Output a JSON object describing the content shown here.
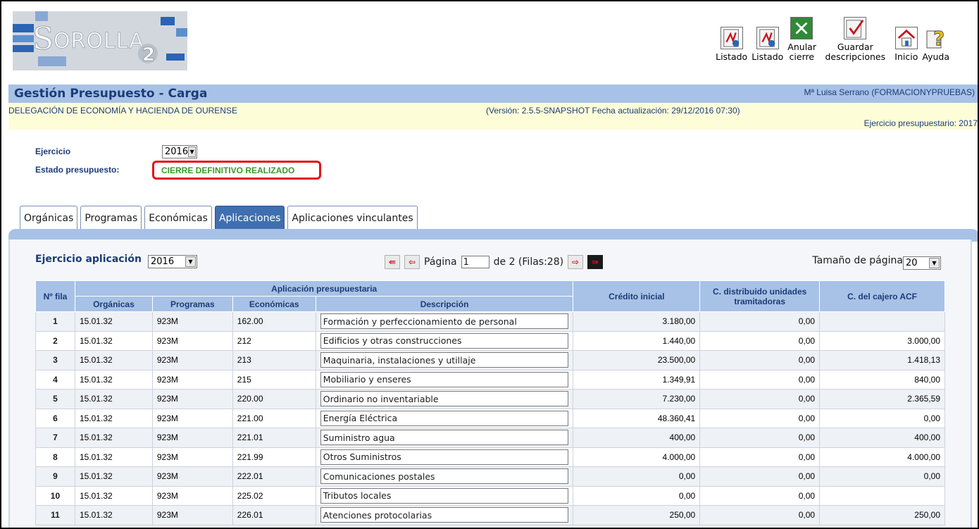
{
  "logo": {
    "text": "Sorolla",
    "number": "2"
  },
  "toolbar": [
    {
      "label": "Listado",
      "icon": "pdf-report-icon"
    },
    {
      "label": "Listado",
      "icon": "pdf-report-icon"
    },
    {
      "label": "Anular cierre",
      "icon": "cancel-x-icon"
    },
    {
      "label": "Guardar descripciones",
      "icon": "save-check-icon"
    },
    {
      "label": "Inicio",
      "icon": "home-icon"
    },
    {
      "label": "Ayuda",
      "icon": "help-icon"
    }
  ],
  "header": {
    "title": "Gestión Presupuesto - Carga",
    "user": "Mª Luisa Serrano (FORMACIONYPRUEBAS)",
    "delegation": "DELEGACIÓN DE ECONOMÍA Y HACIENDA DE OURENSE",
    "version": "(Versión: 2.5.5-SNAPSHOT Fecha actualización: 29/12/2016 07:30)",
    "ejercicio_presupuestario": "Ejercicio presupuestario: 2017"
  },
  "filters": {
    "ejercicio_label": "Ejercicio",
    "ejercicio_value": "2016",
    "estado_label": "Estado presupuesto:",
    "estado_value": "CIERRE DEFINITIVO REALIZADO"
  },
  "tabs": [
    {
      "label": "Orgánicas",
      "active": false
    },
    {
      "label": "Programas",
      "active": false
    },
    {
      "label": "Económicas",
      "active": false
    },
    {
      "label": "Aplicaciones",
      "active": true
    },
    {
      "label": "Aplicaciones vinculantes",
      "active": false
    }
  ],
  "panel": {
    "ejercicio_aplicacion_label": "Ejercicio aplicación",
    "ejercicio_aplicacion_value": "2016",
    "pagina_label": "Página",
    "pagina_value": "1",
    "pagina_total": "de 2 (Filas:28)",
    "tamano_label": "Tamaño de página",
    "tamano_value": "20"
  },
  "table": {
    "headers": {
      "nfila": "Nº fila",
      "aplicacion": "Aplicación presupuestaria",
      "organicas": "Orgánicas",
      "programas": "Programas",
      "economicas": "Económicas",
      "descripcion": "Descripción",
      "credito": "Crédito inicial",
      "distribuido": "C. distribuido unidades tramitadoras",
      "cajero": "C. del cajero ACF"
    },
    "rows": [
      {
        "n": "1",
        "org": "15.01.32",
        "prog": "923M",
        "eco": "162.00",
        "desc": "Formación y perfeccionamiento de personal",
        "credito": "3.180,00",
        "distribuido": "0,00",
        "cajero": ""
      },
      {
        "n": "2",
        "org": "15.01.32",
        "prog": "923M",
        "eco": "212",
        "desc": "Edificios y otras construcciones",
        "credito": "1.440,00",
        "distribuido": "0,00",
        "cajero": "3.000,00"
      },
      {
        "n": "3",
        "org": "15.01.32",
        "prog": "923M",
        "eco": "213",
        "desc": "Maquinaria, instalaciones y utillaje",
        "credito": "23.500,00",
        "distribuido": "0,00",
        "cajero": "1.418,13"
      },
      {
        "n": "4",
        "org": "15.01.32",
        "prog": "923M",
        "eco": "215",
        "desc": "Mobiliario y enseres",
        "credito": "1.349,91",
        "distribuido": "0,00",
        "cajero": "840,00"
      },
      {
        "n": "5",
        "org": "15.01.32",
        "prog": "923M",
        "eco": "220.00",
        "desc": "Ordinario no inventariable",
        "credito": "7.230,00",
        "distribuido": "0,00",
        "cajero": "2.365,59"
      },
      {
        "n": "6",
        "org": "15.01.32",
        "prog": "923M",
        "eco": "221.00",
        "desc": "Energía Eléctrica",
        "credito": "48.360,41",
        "distribuido": "0,00",
        "cajero": "0,00"
      },
      {
        "n": "7",
        "org": "15.01.32",
        "prog": "923M",
        "eco": "221.01",
        "desc": "Suministro agua",
        "credito": "400,00",
        "distribuido": "0,00",
        "cajero": "400,00"
      },
      {
        "n": "8",
        "org": "15.01.32",
        "prog": "923M",
        "eco": "221.99",
        "desc": "Otros Suministros",
        "credito": "4.000,00",
        "distribuido": "0,00",
        "cajero": "4.000,00"
      },
      {
        "n": "9",
        "org": "15.01.32",
        "prog": "923M",
        "eco": "222.01",
        "desc": "Comunicaciones postales",
        "credito": "0,00",
        "distribuido": "0,00",
        "cajero": "0,00"
      },
      {
        "n": "10",
        "org": "15.01.32",
        "prog": "923M",
        "eco": "225.02",
        "desc": "Tributos locales",
        "credito": "0,00",
        "distribuido": "0,00",
        "cajero": ""
      },
      {
        "n": "11",
        "org": "15.01.32",
        "prog": "923M",
        "eco": "226.01",
        "desc": "Atenciones protocolarias",
        "credito": "250,00",
        "distribuido": "0,00",
        "cajero": "250,00"
      }
    ]
  },
  "colors": {
    "header_bar": "#a7c2e6",
    "info_bar": "#fdfdd8",
    "title_text": "#1c3c78",
    "estado_text": "#3a9a2a",
    "highlight_border": "#e0141a",
    "active_tab": "#3f6fb0"
  }
}
